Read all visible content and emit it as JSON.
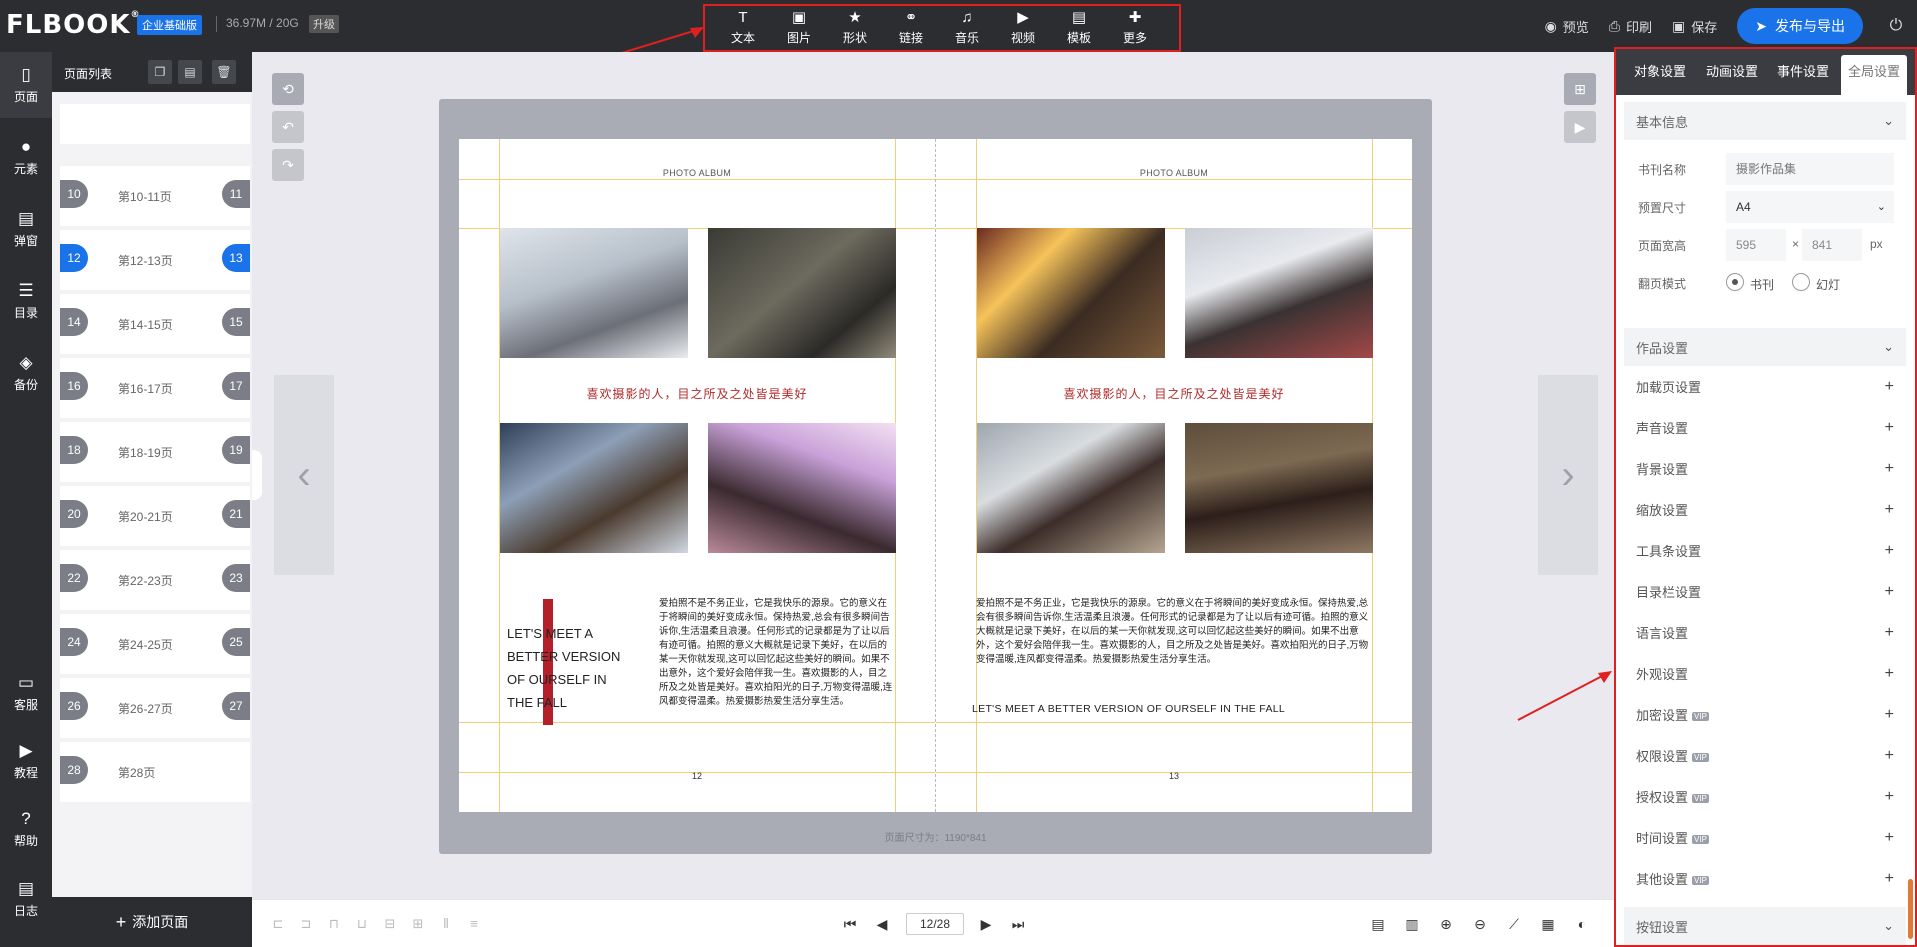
{
  "header": {
    "logo_text": "FLBOOK",
    "logo_mark": "®",
    "edition_badge": "企业基础版",
    "storage": "36.97M / 20G",
    "upgrade": "升级"
  },
  "toolbar": [
    {
      "label": "文本",
      "icon": "T"
    },
    {
      "label": "图片",
      "icon": "▣"
    },
    {
      "label": "形状",
      "icon": "★"
    },
    {
      "label": "链接",
      "icon": "⚭"
    },
    {
      "label": "音乐",
      "icon": "♫"
    },
    {
      "label": "视频",
      "icon": "▶"
    },
    {
      "label": "模板",
      "icon": "▤"
    },
    {
      "label": "更多",
      "icon": "✚"
    }
  ],
  "top_actions": {
    "preview": "预览",
    "print": "印刷",
    "save": "保存",
    "publish": "发布与导出"
  },
  "iconbar": [
    {
      "label": "页面",
      "icon": "▯"
    },
    {
      "label": "元素",
      "icon": "●"
    },
    {
      "label": "弹窗",
      "icon": "▤"
    },
    {
      "label": "目录",
      "icon": "☰"
    },
    {
      "label": "备份",
      "icon": "◈"
    },
    {
      "label": "客服",
      "icon": "▭"
    },
    {
      "label": "教程",
      "icon": "▶"
    },
    {
      "label": "帮助",
      "icon": "?"
    },
    {
      "label": "日志",
      "icon": "▤"
    }
  ],
  "page_panel": {
    "title": "页面列表",
    "add_page": "添加页面",
    "pages": [
      {
        "left": "10",
        "label": "第10-11页",
        "right": "11"
      },
      {
        "left": "12",
        "label": "第12-13页",
        "right": "13"
      },
      {
        "left": "14",
        "label": "第14-15页",
        "right": "15"
      },
      {
        "left": "16",
        "label": "第16-17页",
        "right": "17"
      },
      {
        "left": "18",
        "label": "第18-19页",
        "right": "19"
      },
      {
        "left": "20",
        "label": "第20-21页",
        "right": "21"
      },
      {
        "left": "22",
        "label": "第22-23页",
        "right": "23"
      },
      {
        "left": "24",
        "label": "第24-25页",
        "right": "25"
      },
      {
        "left": "26",
        "label": "第26-27页",
        "right": "27"
      },
      {
        "left": "28",
        "label": "第28页",
        "right": ""
      }
    ]
  },
  "spread": {
    "album_title": "PHOTO ALBUM",
    "caption": "喜欢摄影的人，目之所及之处皆是美好",
    "meet_big": "LET'S MEET A BETTER VERSION OF OURSELF IN THE FALL",
    "meet_small": "LET'S MEET A BETTER VERSION OF OURSELF IN THE FALL",
    "body_left": "爱拍照不是不务正业，它是我快乐的源泉。它的意义在于将瞬间的美好变成永恒。保持热爱,总会有很多瞬间告诉你,生活温柔且浪漫。任何形式的记录都是为了让以后有迹可循。拍照的意义大概就是记录下美好，在以后的某一天你就发现,这可以回忆起这些美好的瞬间。如果不出意外，这个爱好会陪伴我一生。喜欢摄影的人，目之所及之处皆是美好。喜欢拍阳光的日子,万物变得温暖,连风都变得温柔。热爱摄影热爱生活分享生活。",
    "body_right": "爱拍照不是不务正业，它是我快乐的源泉。它的意义在于将瞬间的美好变成永恒。保持热爱,总会有很多瞬间告诉你,生活温柔且浪漫。任何形式的记录都是为了让以后有迹可循。拍照的意义大概就是记录下美好，在以后的某一天你就发现,这可以回忆起这些美好的瞬间。如果不出意外，这个爱好会陪伴我一生。喜欢摄影的人，目之所及之处皆是美好。喜欢拍阳光的日子,万物变得温暖,连风都变得温柔。热爱摄影热爱生活分享生活。",
    "page_left": "12",
    "page_right": "13",
    "page_size": "页面尺寸为：1190*841"
  },
  "bottom": {
    "page_indicator": "12/28"
  },
  "right_panel": {
    "tabs": [
      "对象设置",
      "动画设置",
      "事件设置",
      "全局设置"
    ],
    "basic_title": "基本信息",
    "book_name_label": "书刊名称",
    "book_name_placeholder": "摄影作品集",
    "preset_size_label": "预置尺寸",
    "preset_size_value": "A4",
    "page_wh_label": "页面宽高",
    "width": "595",
    "height": "841",
    "times": "×",
    "unit": "px",
    "flip_mode_label": "翻页模式",
    "flip_book": "书刊",
    "flip_slide": "幻灯",
    "work_settings_title": "作品设置",
    "settings": [
      {
        "label": "加载页设置",
        "vip": ""
      },
      {
        "label": "声音设置",
        "vip": ""
      },
      {
        "label": "背景设置",
        "vip": ""
      },
      {
        "label": "缩放设置",
        "vip": ""
      },
      {
        "label": "工具条设置",
        "vip": ""
      },
      {
        "label": "目录栏设置",
        "vip": ""
      },
      {
        "label": "语言设置",
        "vip": ""
      },
      {
        "label": "外观设置",
        "vip": ""
      },
      {
        "label": "加密设置",
        "vip": "VIP"
      },
      {
        "label": "权限设置",
        "vip": "VIP"
      },
      {
        "label": "授权设置",
        "vip": "VIP"
      },
      {
        "label": "时间设置",
        "vip": "VIP"
      },
      {
        "label": "其他设置",
        "vip": "VIP"
      }
    ],
    "button_settings_title": "按钮设置"
  },
  "colors": {
    "accent": "#1a73e8",
    "highlight_border": "#e02020",
    "dark_bar": "#2b2d31"
  }
}
